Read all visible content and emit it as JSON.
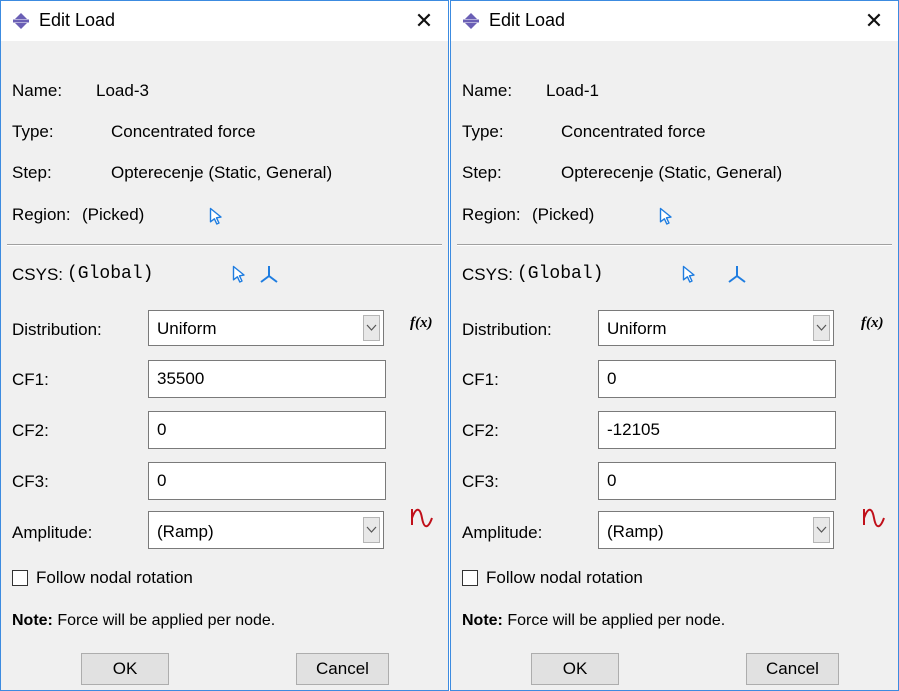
{
  "dialogs": [
    {
      "title": "Edit Load",
      "name_label": "Name:",
      "name": "Load-3",
      "type_label": "Type:",
      "type": "Concentrated force",
      "step_label": "Step:",
      "step": "Opterecenje (Static, General)",
      "region_label": "Region:",
      "region": "(Picked)",
      "csys_label": "CSYS:",
      "csys": "(Global)",
      "distribution_label": "Distribution:",
      "distribution": "Uniform",
      "fx": "f(x)",
      "cf1_label": "CF1:",
      "cf1": "35500",
      "cf2_label": "CF2:",
      "cf2": "0",
      "cf3_label": "CF3:",
      "cf3": "0",
      "amplitude_label": "Amplitude:",
      "amplitude": "(Ramp)",
      "follow_label": "Follow nodal rotation",
      "follow_checked": false,
      "note_prefix": "Note:",
      "note_text": "Force will be applied per node.",
      "ok_label": "OK",
      "cancel_label": "Cancel"
    },
    {
      "title": "Edit Load",
      "name_label": "Name:",
      "name": "Load-1",
      "type_label": "Type:",
      "type": "Concentrated force",
      "step_label": "Step:",
      "step": "Opterecenje (Static, General)",
      "region_label": "Region:",
      "region": "(Picked)",
      "csys_label": "CSYS:",
      "csys": "(Global)",
      "distribution_label": "Distribution:",
      "distribution": "Uniform",
      "fx": "f(x)",
      "cf1_label": "CF1:",
      "cf1": "0",
      "cf2_label": "CF2:",
      "cf2": "-12105",
      "cf3_label": "CF3:",
      "cf3": "0",
      "amplitude_label": "Amplitude:",
      "amplitude": "(Ramp)",
      "follow_label": "Follow nodal rotation",
      "follow_checked": false,
      "note_prefix": "Note:",
      "note_text": "Force will be applied per node.",
      "ok_label": "OK",
      "cancel_label": "Cancel"
    }
  ],
  "colors": {
    "window_border": "#3c8be0",
    "dialog_bg": "#f0f0f0",
    "pick_icon": "#1f7de0",
    "amplitude_icon": "#c0101a"
  },
  "icons": {
    "title": "load-arrows-icon",
    "close": "close-icon",
    "pick": "pick-arrow-icon",
    "csys": "coordinate-axes-icon",
    "function": "fx-icon",
    "amplitude": "amplitude-wave-icon",
    "dropdown": "chevron-down-icon"
  }
}
